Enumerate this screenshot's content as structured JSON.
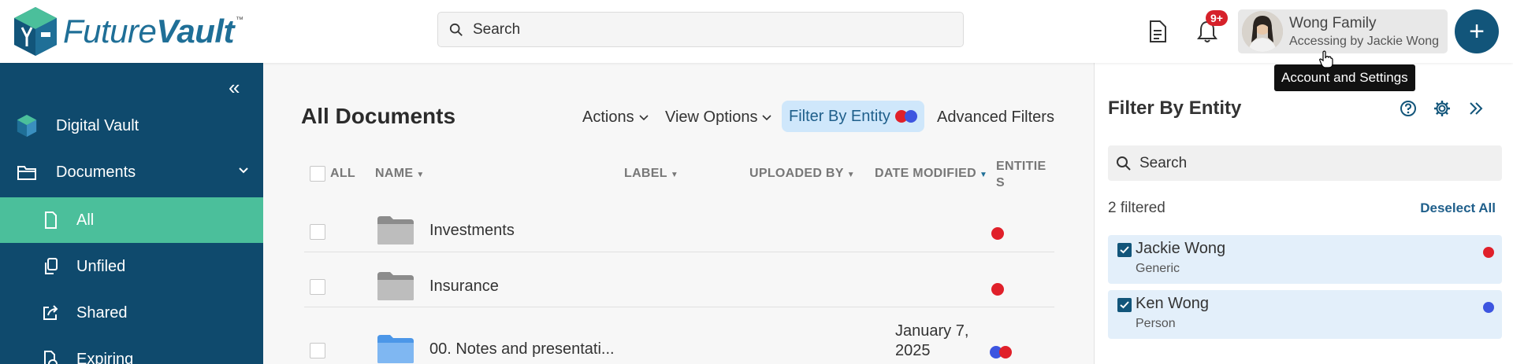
{
  "header": {
    "logo": {
      "text_a": "Future",
      "text_b": "Vault",
      "tm": "™"
    },
    "search_placeholder": "Search",
    "notifications_badge": "9+",
    "account": {
      "name": "Wong Family",
      "sub": "Accessing by Jackie Wong"
    },
    "tooltip": "Account and Settings"
  },
  "sidebar": {
    "items": [
      {
        "label": "Digital Vault",
        "icon": "vault-logo-icon"
      },
      {
        "label": "Documents",
        "icon": "folder-icon"
      },
      {
        "label": "All",
        "icon": "document-icon",
        "active": true
      },
      {
        "label": "Unfiled",
        "icon": "copy-icon"
      },
      {
        "label": "Shared",
        "icon": "share-icon"
      },
      {
        "label": "Expiring",
        "icon": "expiring-icon"
      }
    ]
  },
  "main": {
    "title": "All Documents",
    "toolbar": {
      "actions": "Actions",
      "view_options": "View Options",
      "filter_by_entity": "Filter By Entity",
      "advanced_filters": "Advanced Filters"
    },
    "columns": {
      "all": "ALL",
      "name": "NAME",
      "label": "LABEL",
      "uploaded_by": "UPLOADED BY",
      "date_modified": "DATE MODIFIED",
      "entities_a": "ENTITIE",
      "entities_b": "S"
    },
    "rows": [
      {
        "name": "Investments",
        "date_a": "",
        "date_b": "",
        "entities": [
          "red"
        ],
        "folder_color": "gray"
      },
      {
        "name": "Insurance",
        "date_a": "",
        "date_b": "",
        "entities": [
          "red"
        ],
        "folder_color": "gray"
      },
      {
        "name": "00. Notes and presentati...",
        "date_a": "January 7,",
        "date_b": "2025",
        "entities": [
          "blue",
          "red"
        ],
        "folder_color": "blue"
      }
    ]
  },
  "filter_panel": {
    "title": "Filter By Entity",
    "search_placeholder": "Search",
    "count": "2 filtered",
    "deselect": "Deselect All",
    "entities": [
      {
        "name": "Jackie Wong",
        "type": "Generic",
        "color": "#e0202a"
      },
      {
        "name": "Ken Wong",
        "type": "Person",
        "color": "#3d55e0"
      }
    ]
  },
  "colors": {
    "red": "#e0202a",
    "blue": "#3d55e0",
    "brand": "#12557a",
    "sidebar": "#0f4a6d",
    "active": "#4bbf9b"
  }
}
